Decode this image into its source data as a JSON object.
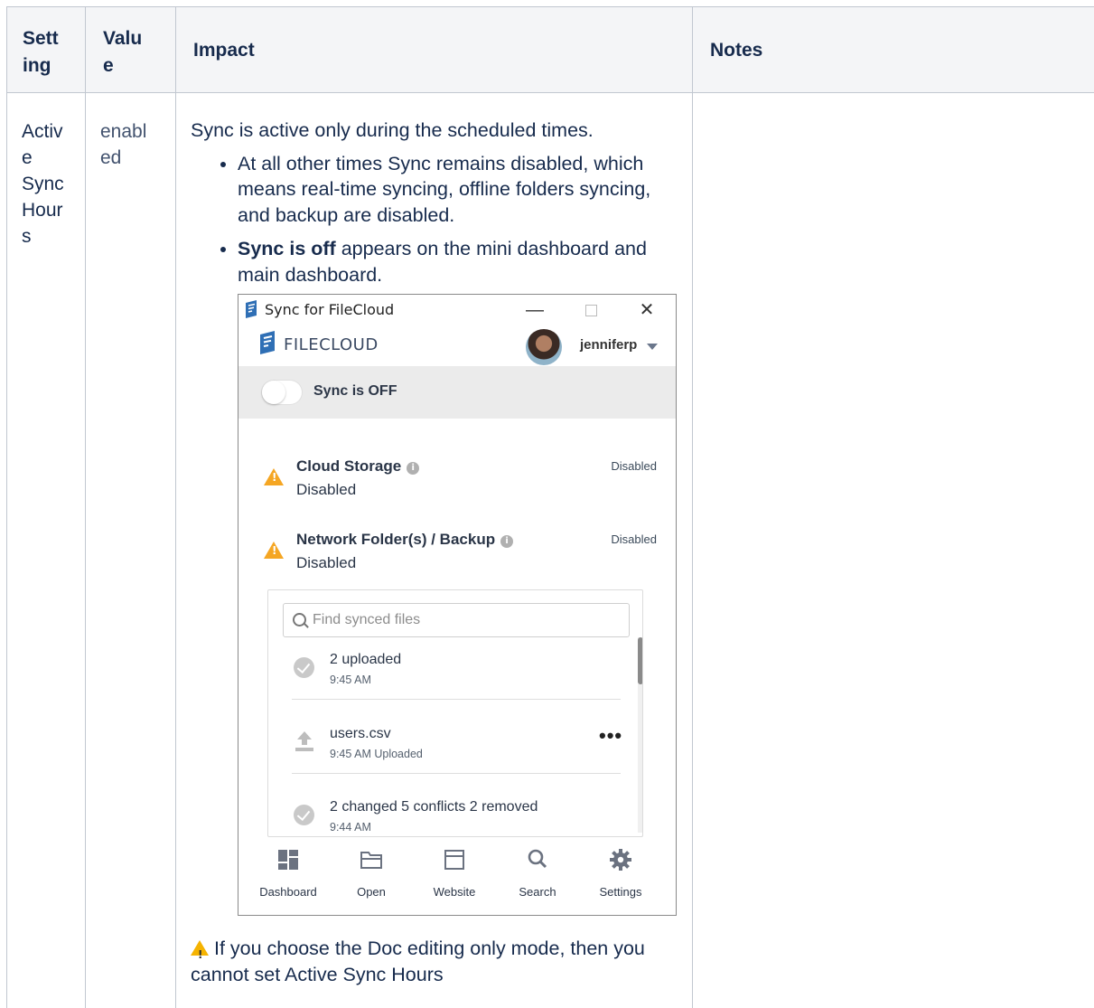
{
  "table": {
    "headers": [
      "Sett ing",
      "Valu e",
      "Impact",
      "Notes"
    ],
    "header_lines": {
      "setting": [
        "Sett",
        "ing"
      ],
      "value": [
        "Valu",
        "e"
      ],
      "impact": "Impact",
      "notes": "Notes"
    },
    "row": {
      "setting_lines": [
        "Activ",
        "e",
        "Sync",
        "Hour",
        "s"
      ],
      "value_lines": [
        "enabl",
        "ed"
      ],
      "impact_intro": "Sync is active only during the scheduled times.",
      "bullet1": "At all other times Sync remains disabled, which means real-time syncing, offline folders syncing, and backup are disabled.",
      "bullet2_bold": "Sync is off",
      "bullet2_rest": " appears on the mini dashboard and main dashboard.",
      "warning_note": "If you choose the Doc editing only mode, then you cannot set Active Sync Hours"
    }
  },
  "app": {
    "window_title": "Sync for FileCloud",
    "brand": "FILECLOUD",
    "username": "jenniferp",
    "sync_label": "Sync is OFF",
    "sync_on": false,
    "status_items": [
      {
        "title": "Cloud Storage",
        "sub": "Disabled",
        "right": "Disabled"
      },
      {
        "title": "Network Folder(s) / Backup",
        "sub": "Disabled",
        "right": "Disabled"
      }
    ],
    "search_placeholder": "Find synced files",
    "files": [
      {
        "title": "2 uploaded",
        "time": "9:45 AM",
        "icon": "check-icon"
      },
      {
        "title": "users.csv",
        "time": "9:45 AM Uploaded",
        "icon": "upload-icon"
      },
      {
        "title": "2 changed 5 conflicts 2 removed",
        "time": "9:44 AM",
        "icon": "check-icon"
      }
    ],
    "nav": [
      {
        "label": "Dashboard",
        "icon": "dashboard-icon"
      },
      {
        "label": "Open",
        "icon": "folder-icon"
      },
      {
        "label": "Website",
        "icon": "browser-icon"
      },
      {
        "label": "Search",
        "icon": "search-icon"
      },
      {
        "label": "Settings",
        "icon": "gear-icon"
      }
    ],
    "colors": {
      "warning": "#f5a623",
      "brand": "#2f6fb5",
      "sync_bar": "#ebebeb"
    }
  }
}
